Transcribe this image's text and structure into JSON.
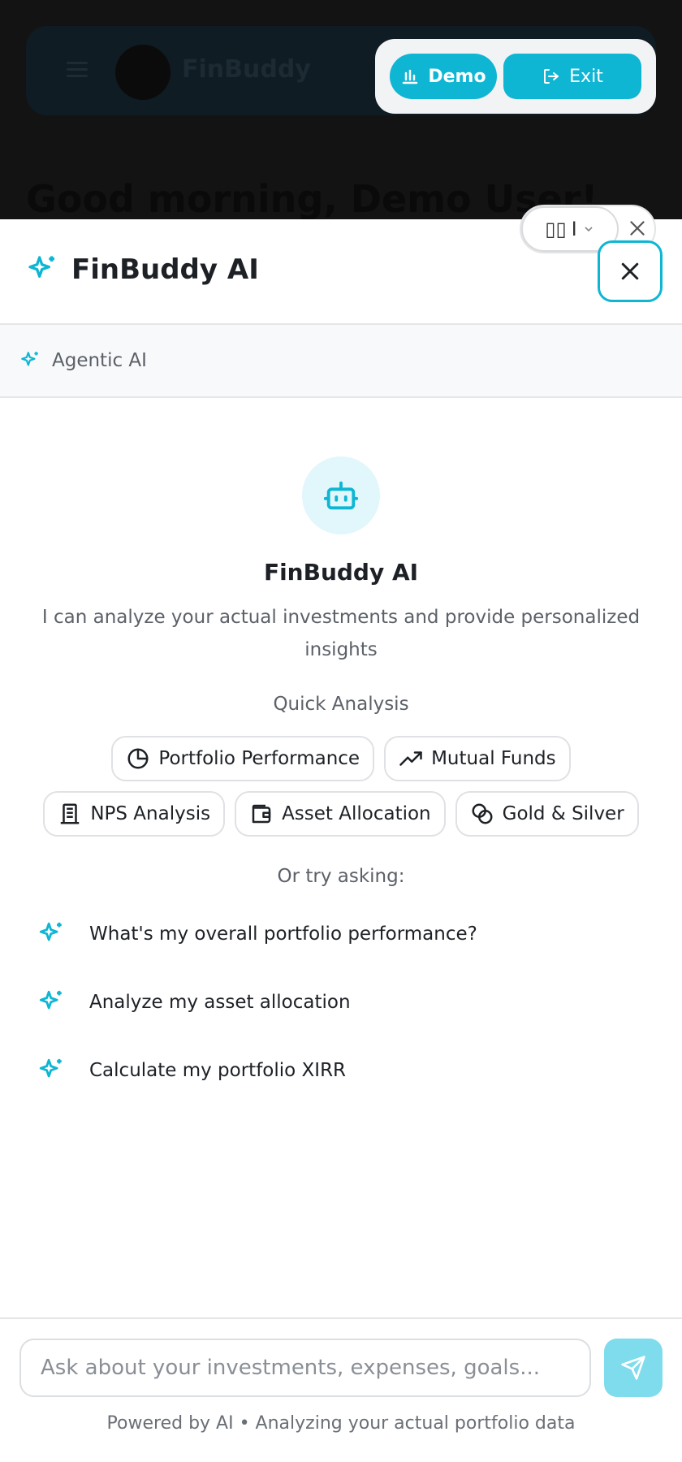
{
  "background": {
    "brand": "FinBuddy",
    "greeting": "Good morning, Demo User!"
  },
  "top_actions": {
    "demo_label": "Demo",
    "exit_label": "Exit"
  },
  "panel": {
    "title": "FinBuddy AI",
    "language_label": "I",
    "mode_label": "Agentic AI",
    "assistant": {
      "name": "FinBuddy AI",
      "description": "I can analyze your actual investments and provide personalized insights"
    },
    "quick_analysis": {
      "label": "Quick Analysis",
      "chips": [
        {
          "label": "Portfolio Performance",
          "icon": "pie-chart-icon"
        },
        {
          "label": "Mutual Funds",
          "icon": "trending-up-icon"
        },
        {
          "label": "NPS Analysis",
          "icon": "building-icon"
        },
        {
          "label": "Asset Allocation",
          "icon": "wallet-icon"
        },
        {
          "label": "Gold & Silver",
          "icon": "coins-icon"
        }
      ]
    },
    "try_asking": {
      "label": "Or try asking:",
      "suggestions": [
        "What's my overall portfolio performance?",
        "Analyze my asset allocation",
        "Calculate my portfolio XIRR"
      ]
    },
    "composer": {
      "placeholder": "Ask about your investments, expenses, goals...",
      "value": ""
    },
    "footer_note": "Powered by AI • Analyzing your actual portfolio data"
  },
  "colors": {
    "accent": "#0eb6d4",
    "accent_light": "#e1f7fb",
    "send_disabled": "#7fdcec"
  }
}
